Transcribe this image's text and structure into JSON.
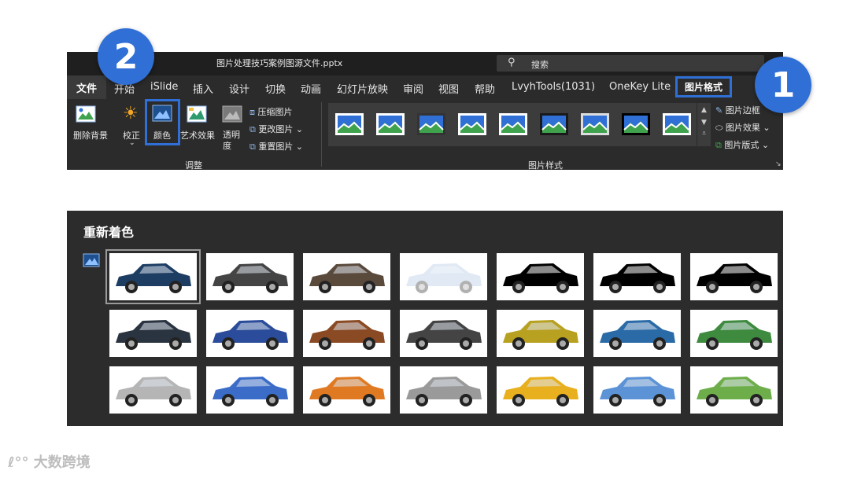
{
  "window": {
    "title": "图片处理技巧案例图源文件.pptx",
    "search_placeholder": "搜索"
  },
  "tabs": [
    {
      "label": "文件",
      "name": "tab-file"
    },
    {
      "label": "开始",
      "name": "tab-home"
    },
    {
      "label": "iSlide",
      "name": "tab-islide"
    },
    {
      "label": "插入",
      "name": "tab-insert"
    },
    {
      "label": "设计",
      "name": "tab-design"
    },
    {
      "label": "切换",
      "name": "tab-transitions"
    },
    {
      "label": "动画",
      "name": "tab-animations"
    },
    {
      "label": "幻灯片放映",
      "name": "tab-slideshow"
    },
    {
      "label": "审阅",
      "name": "tab-review"
    },
    {
      "label": "视图",
      "name": "tab-view"
    },
    {
      "label": "帮助",
      "name": "tab-help"
    },
    {
      "label": "LvyhTools(1031)",
      "name": "tab-lvyhtools"
    },
    {
      "label": "OneKey Lite",
      "name": "tab-onekey"
    },
    {
      "label": "图片格式",
      "name": "tab-picture-format"
    }
  ],
  "adjust": {
    "remove_bg": "删除背景",
    "corrections": "校正",
    "color": "颜色",
    "artistic": "艺术效果",
    "transparency_line1": "透明",
    "transparency_line2": "度",
    "compress": "压缩图片",
    "change": "更改图片",
    "reset": "重置图片",
    "group": "调整"
  },
  "styles": {
    "group": "图片样式",
    "border": "图片边框",
    "effects": "图片效果",
    "layout": "图片版式"
  },
  "badges": {
    "one": "1",
    "two": "2"
  },
  "recolor": {
    "title": "重新着色",
    "rows": [
      [
        "#1d3d63",
        "#444444",
        "#5a4a3c",
        "#a9c3e2",
        "bw",
        "bw",
        "bw"
      ],
      [
        "#2a3440",
        "#2b4c9a",
        "#8a4a24",
        "#444444",
        "#b8a020",
        "#2a6aa6",
        "#3e8a3e"
      ],
      [
        "#b5b5b5",
        "#3a6cc8",
        "#e07a22",
        "#9a9a9a",
        "#e8b01e",
        "#5b93d6",
        "#6dae4a"
      ]
    ]
  },
  "colors": {
    "accent": "#2f6fd6",
    "ribbon": "#2b2b2b",
    "panel": "#2d2c2c"
  },
  "watermark": {
    "text": "大数跨境"
  }
}
